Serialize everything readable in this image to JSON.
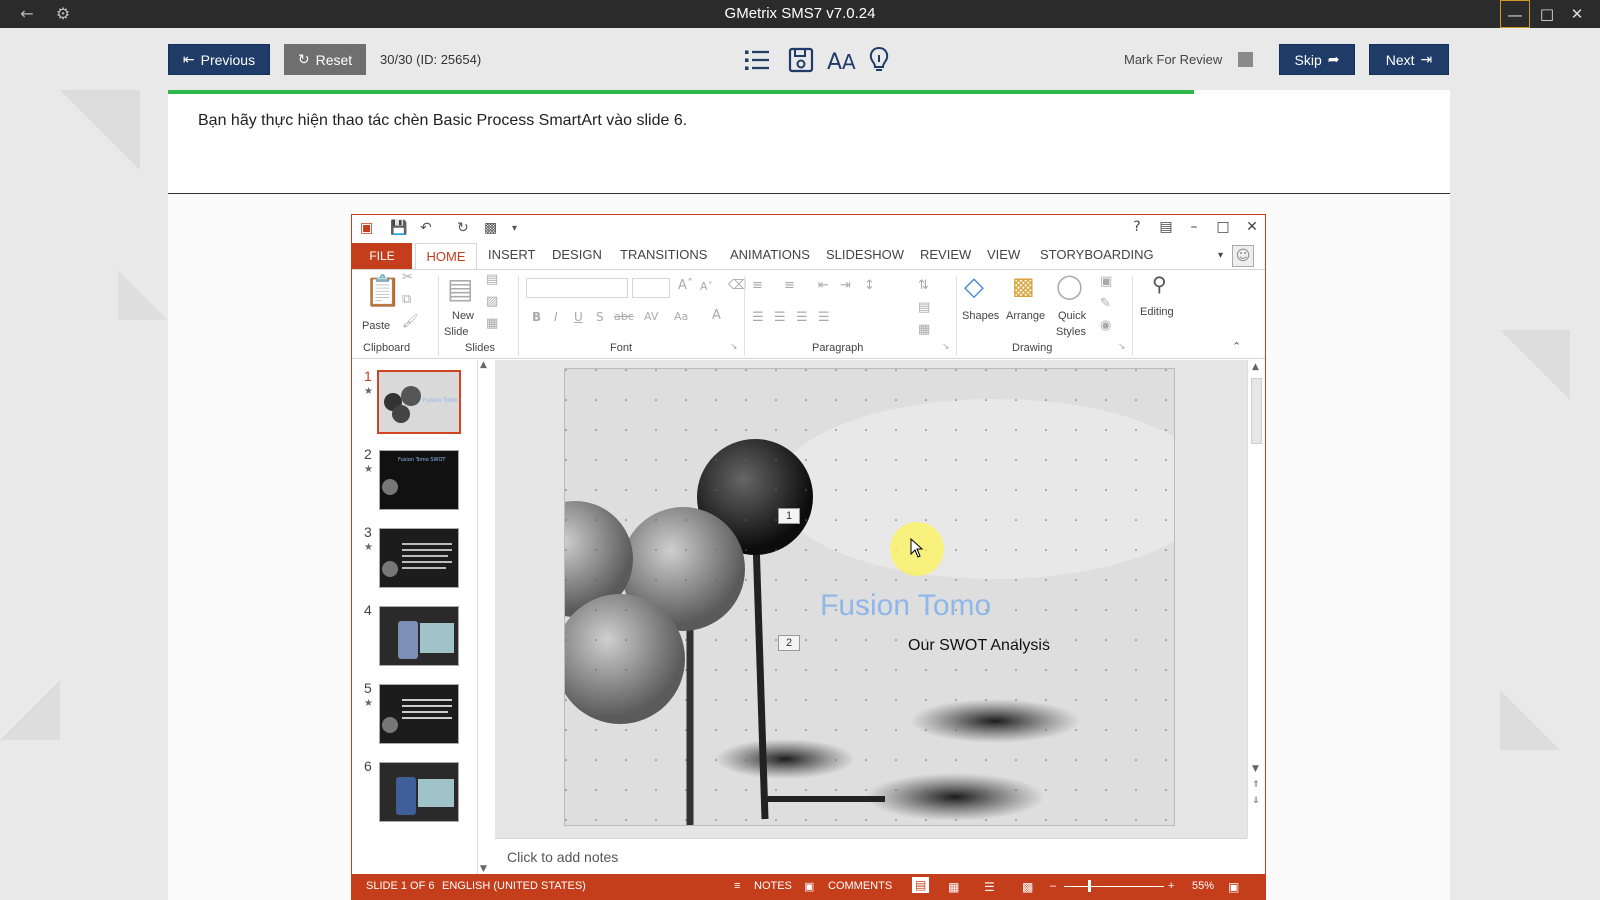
{
  "app": {
    "title": "GMetrix SMS7 v7.0.24"
  },
  "toolbar": {
    "previous_label": "Previous",
    "reset_label": "Reset",
    "counter": "30/30 (ID: 25654)",
    "mark_review_label": "Mark For Review",
    "skip_label": "Skip",
    "next_label": "Next"
  },
  "question": {
    "text": "Bạn hãy thực hiện thao tác chèn Basic Process SmartArt vào slide 6.",
    "progress_fraction": 0.8
  },
  "ppt": {
    "tabs": [
      "FILE",
      "HOME",
      "INSERT",
      "DESIGN",
      "TRANSITIONS",
      "ANIMATIONS",
      "SLIDESHOW",
      "REVIEW",
      "VIEW",
      "STORYBOARDING"
    ],
    "groups": {
      "clipboard": "Clipboard",
      "slides": "Slides",
      "font": "Font",
      "paragraph": "Paragraph",
      "drawing": "Drawing"
    },
    "buttons": {
      "paste": "Paste",
      "new_line1": "New",
      "new_line2": "Slide",
      "shapes": "Shapes",
      "arrange": "Arrange",
      "quick_line1": "Quick",
      "quick_line2": "Styles",
      "editing": "Editing"
    },
    "thumbnails": [
      "1",
      "2",
      "3",
      "4",
      "5",
      "6"
    ],
    "slide": {
      "title": "Fusion Tomo",
      "subtitle": "Our SWOT Analysis",
      "placeholder_1": "1",
      "placeholder_2": "2"
    },
    "notes_placeholder": "Click to add notes",
    "status": {
      "slide_info": "SLIDE 1 OF 6",
      "language": "ENGLISH (UNITED STATES)",
      "notes": "NOTES",
      "comments": "COMMENTS",
      "zoom": "55%"
    }
  },
  "colors": {
    "accent_dark": "#1f3b67",
    "progress": "#2db84d",
    "ppt_accent": "#c43e1c",
    "title_blue": "#8fb7ea"
  }
}
